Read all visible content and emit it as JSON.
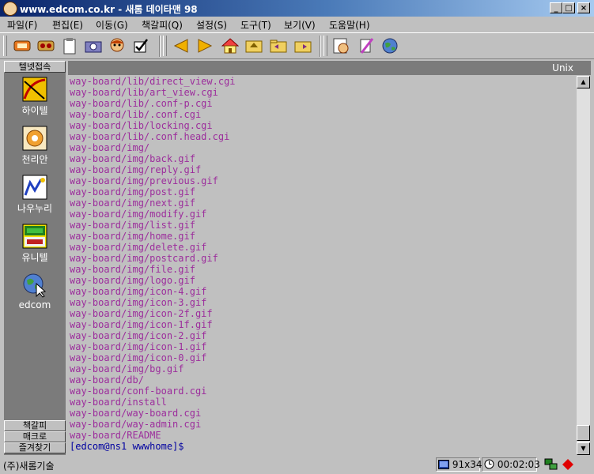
{
  "window": {
    "title": "www.edcom.co.kr - 새롬 데이타맨 98",
    "min": "_",
    "max": "□",
    "close": "×"
  },
  "menu": [
    {
      "label": "파일(F)"
    },
    {
      "label": "편집(E)"
    },
    {
      "label": "이동(G)"
    },
    {
      "label": "책갈피(Q)"
    },
    {
      "label": "설정(S)"
    },
    {
      "label": "도구(T)"
    },
    {
      "label": "보기(V)"
    },
    {
      "label": "도움말(H)"
    }
  ],
  "toolbar": {
    "icons": [
      "connect-icon",
      "disconnect-icon",
      "clipboard-icon",
      "capture-icon",
      "character-icon",
      "check-icon",
      "back-arrow-icon",
      "forward-arrow-icon",
      "home-icon",
      "upload-icon",
      "folder-icon",
      "download-icon",
      "settings-icon",
      "edit-icon",
      "globe-icon"
    ]
  },
  "leftpanel": {
    "header": "텔넷접속",
    "shortcuts": [
      {
        "label": "하이텔",
        "icon": "hitel-icon"
      },
      {
        "label": "천리안",
        "icon": "chollian-icon"
      },
      {
        "label": "나우누리",
        "icon": "nownuri-icon"
      },
      {
        "label": "유니텔",
        "icon": "unitel-icon"
      },
      {
        "label": "edcom",
        "icon": "edcom-globe-icon"
      }
    ],
    "buttons": [
      "책갈피",
      "매크로",
      "즐겨찾기"
    ]
  },
  "terminal": {
    "mode": "Unix",
    "lines": [
      "way-board/lib/direct_view.cgi",
      "way-board/lib/art_view.cgi",
      "way-board/lib/.conf-p.cgi",
      "way-board/lib/.conf.cgi",
      "way-board/lib/locking.cgi",
      "way-board/lib/.conf.head.cgi",
      "way-board/img/",
      "way-board/img/back.gif",
      "way-board/img/reply.gif",
      "way-board/img/previous.gif",
      "way-board/img/post.gif",
      "way-board/img/next.gif",
      "way-board/img/modify.gif",
      "way-board/img/list.gif",
      "way-board/img/home.gif",
      "way-board/img/delete.gif",
      "way-board/img/postcard.gif",
      "way-board/img/file.gif",
      "way-board/img/logo.gif",
      "way-board/img/icon-4.gif",
      "way-board/img/icon-3.gif",
      "way-board/img/icon-2f.gif",
      "way-board/img/icon-1f.gif",
      "way-board/img/icon-2.gif",
      "way-board/img/icon-1.gif",
      "way-board/img/icon-0.gif",
      "way-board/img/bg.gif",
      "way-board/db/",
      "way-board/conf-board.cgi",
      "way-board/install",
      "way-board/way-board.cgi",
      "way-board/way-admin.cgi",
      "way-board/README"
    ],
    "prompt": "[edcom@ns1 wwwhome]$"
  },
  "status": {
    "company": "(주)새롬기술",
    "terminal_size": "91x34",
    "timer": "00:02:03"
  },
  "colors": {
    "text": "#9c2d9c",
    "prompt": "#0000a0",
    "panel": "#7b7b7b"
  }
}
